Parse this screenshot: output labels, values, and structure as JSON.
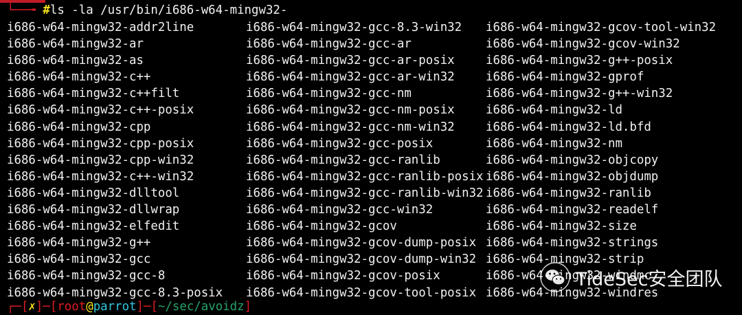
{
  "terminal": {
    "command_corner": "└──╼ ",
    "command_prompt_symbol": "#",
    "command": "ls -la /usr/bin/i686-w64-mingw32-",
    "listing": [
      "i686-w64-mingw32-addr2line",
      "i686-w64-mingw32-gcc-8.3-win32",
      "i686-w64-mingw32-gcov-tool-win32",
      "i686-w64-mingw32-ar",
      "i686-w64-mingw32-gcc-ar",
      "i686-w64-mingw32-gcov-win32",
      "i686-w64-mingw32-as",
      "i686-w64-mingw32-gcc-ar-posix",
      "i686-w64-mingw32-g++-posix",
      "i686-w64-mingw32-c++",
      "i686-w64-mingw32-gcc-ar-win32",
      "i686-w64-mingw32-gprof",
      "i686-w64-mingw32-c++filt",
      "i686-w64-mingw32-gcc-nm",
      "i686-w64-mingw32-g++-win32",
      "i686-w64-mingw32-c++-posix",
      "i686-w64-mingw32-gcc-nm-posix",
      "i686-w64-mingw32-ld",
      "i686-w64-mingw32-cpp",
      "i686-w64-mingw32-gcc-nm-win32",
      "i686-w64-mingw32-ld.bfd",
      "i686-w64-mingw32-cpp-posix",
      "i686-w64-mingw32-gcc-posix",
      "i686-w64-mingw32-nm",
      "i686-w64-mingw32-cpp-win32",
      "i686-w64-mingw32-gcc-ranlib",
      "i686-w64-mingw32-objcopy",
      "i686-w64-mingw32-c++-win32",
      "i686-w64-mingw32-gcc-ranlib-posix",
      "i686-w64-mingw32-objdump",
      "i686-w64-mingw32-dlltool",
      "i686-w64-mingw32-gcc-ranlib-win32",
      "i686-w64-mingw32-ranlib",
      "i686-w64-mingw32-dllwrap",
      "i686-w64-mingw32-gcc-win32",
      "i686-w64-mingw32-readelf",
      "i686-w64-mingw32-elfedit",
      "i686-w64-mingw32-gcov",
      "i686-w64-mingw32-size",
      "i686-w64-mingw32-g++",
      "i686-w64-mingw32-gcov-dump-posix",
      "i686-w64-mingw32-strings",
      "i686-w64-mingw32-gcc",
      "i686-w64-mingw32-gcov-dump-win32",
      "i686-w64-mingw32-strip",
      "i686-w64-mingw32-gcc-8",
      "i686-w64-mingw32-gcov-posix",
      "i686-w64-mingw32-windmc",
      "i686-w64-mingw32-gcc-8.3-posix",
      "i686-w64-mingw32-gcov-tool-posix",
      "i686-w64-mingw32-windres"
    ],
    "next_prompt": {
      "open": "┌─[",
      "status": "✗",
      "sep1": "]─[",
      "user": "root",
      "at": "@",
      "host": "parrot",
      "sep2": "]─[",
      "path": "~/sec/avoidz",
      "close": "]"
    },
    "colors": {
      "background": "#000000",
      "text": "#f2f2f2",
      "prompt_red": "#e01b24",
      "prompt_yellow": "#f9e31a",
      "host_cyan": "#33c7de",
      "path_green": "#26a269"
    }
  },
  "watermark": {
    "icon": "wechat-icon",
    "text": "TideSec安全团队"
  }
}
